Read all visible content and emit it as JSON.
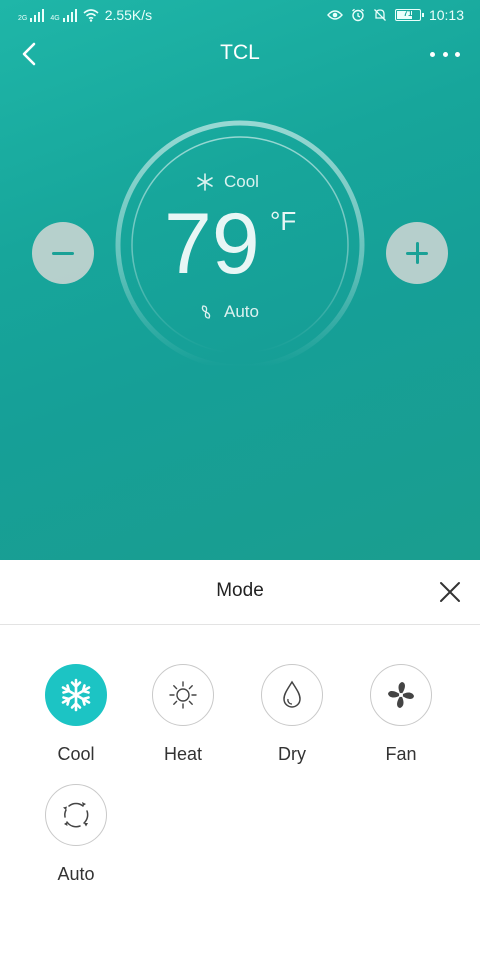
{
  "status_bar": {
    "net1": "2G",
    "net2": "4G",
    "speed": "2.55K/s",
    "battery": "71",
    "battery_level": 0.71,
    "time": "10:13"
  },
  "header": {
    "title": "TCL"
  },
  "dial": {
    "mode": "Cool",
    "temperature": "79",
    "unit": "°F",
    "fan": "Auto"
  },
  "sheet": {
    "title": "Mode",
    "options": [
      {
        "label": "Cool",
        "active": true
      },
      {
        "label": "Heat",
        "active": false
      },
      {
        "label": "Dry",
        "active": false
      },
      {
        "label": "Fan",
        "active": false
      },
      {
        "label": "Auto",
        "active": false
      }
    ]
  },
  "colors": {
    "accent": "#1cc4c4",
    "header_bg": "#17a69b"
  }
}
